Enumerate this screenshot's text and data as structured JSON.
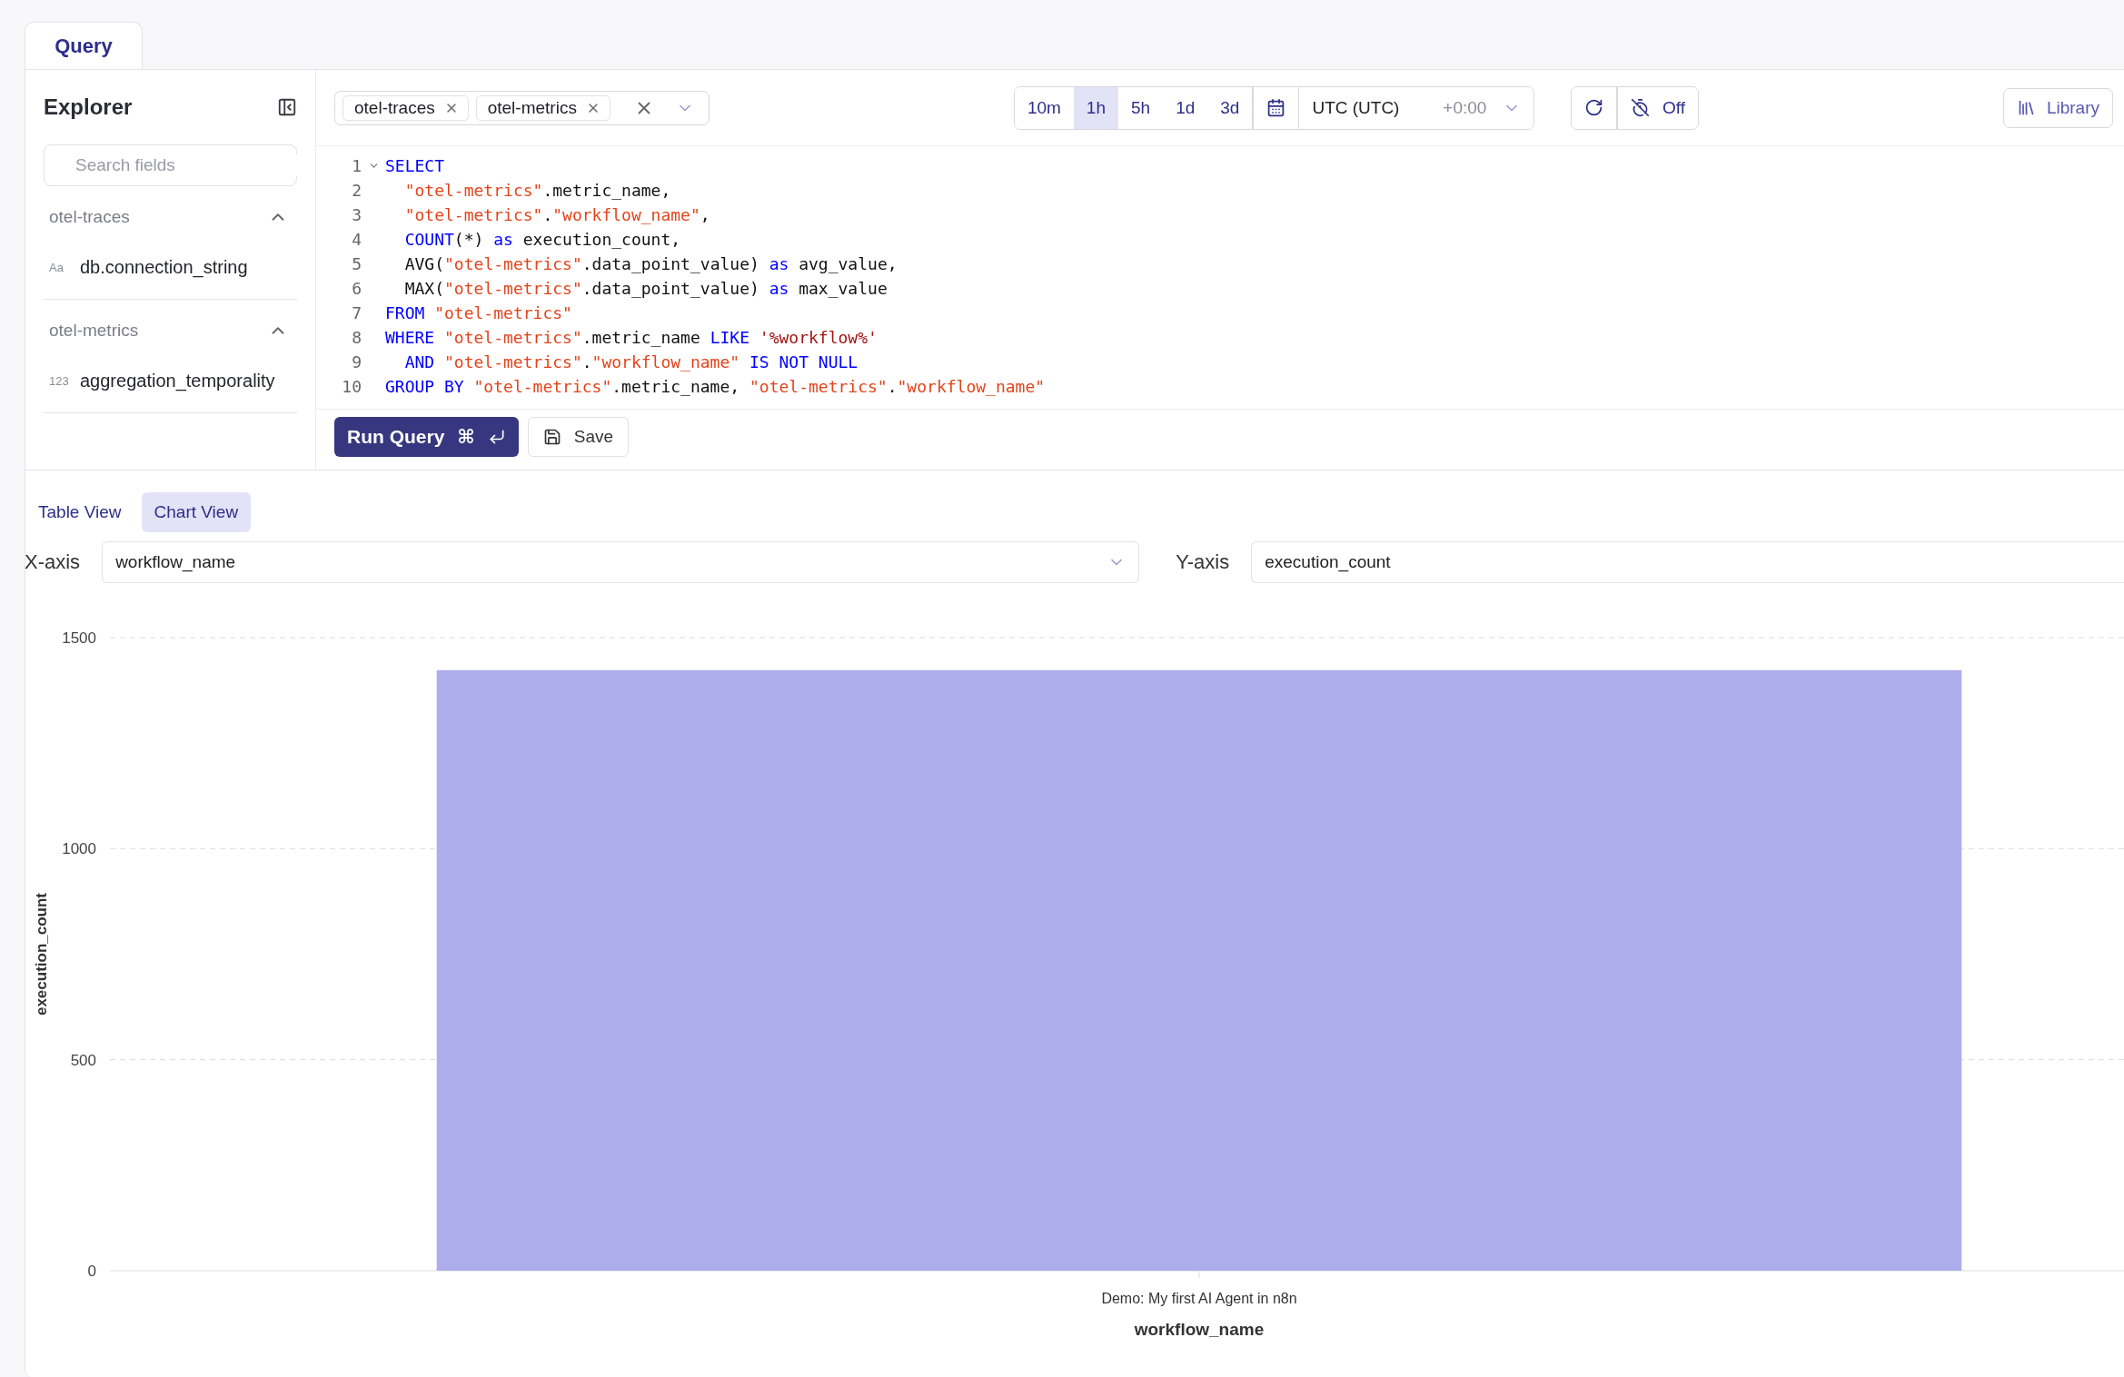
{
  "tabs": [
    {
      "label": "Query",
      "selected": true
    }
  ],
  "explorer": {
    "title": "Explorer",
    "search": {
      "placeholder": "Search fields"
    },
    "groups": [
      {
        "name": "otel-traces",
        "expanded": true,
        "fields": [
          {
            "type_label": "Aa",
            "name": "db.connection_string"
          }
        ]
      },
      {
        "name": "otel-metrics",
        "expanded": true,
        "fields": [
          {
            "type_label": "123",
            "name": "aggregation_temporality"
          }
        ]
      }
    ]
  },
  "sources": [
    "otel-traces",
    "otel-metrics"
  ],
  "time_ranges": [
    {
      "label": "10m",
      "selected": false
    },
    {
      "label": "1h",
      "selected": true
    },
    {
      "label": "5h",
      "selected": false
    },
    {
      "label": "1d",
      "selected": false
    },
    {
      "label": "3d",
      "selected": false
    }
  ],
  "timezone": {
    "name": "UTC (UTC)",
    "offset": "+0:00"
  },
  "auto_refresh": {
    "label": "Off"
  },
  "library_button": "Library",
  "editor": {
    "lines": [
      {
        "number": "1",
        "foldable": true,
        "indented": false,
        "tokens": [
          {
            "kind": "keyword",
            "text": "SELECT"
          }
        ]
      },
      {
        "number": "2",
        "foldable": false,
        "indented": true,
        "tokens": [
          {
            "kind": "identifier",
            "text": "\"otel-metrics\""
          },
          {
            "kind": "plain",
            "text": ".metric_name,"
          }
        ]
      },
      {
        "number": "3",
        "foldable": false,
        "indented": true,
        "tokens": [
          {
            "kind": "identifier",
            "text": "\"otel-metrics\""
          },
          {
            "kind": "plain",
            "text": "."
          },
          {
            "kind": "identifier",
            "text": "\"workflow_name\""
          },
          {
            "kind": "plain",
            "text": ","
          }
        ]
      },
      {
        "number": "4",
        "foldable": false,
        "indented": true,
        "tokens": [
          {
            "kind": "keyword",
            "text": "COUNT"
          },
          {
            "kind": "plain",
            "text": "(*) "
          },
          {
            "kind": "keyword",
            "text": "as"
          },
          {
            "kind": "plain",
            "text": " execution_count,"
          }
        ]
      },
      {
        "number": "5",
        "foldable": false,
        "indented": true,
        "tokens": [
          {
            "kind": "plain",
            "text": "AVG("
          },
          {
            "kind": "identifier",
            "text": "\"otel-metrics\""
          },
          {
            "kind": "plain",
            "text": ".data_point_value) "
          },
          {
            "kind": "keyword",
            "text": "as"
          },
          {
            "kind": "plain",
            "text": " avg_value,"
          }
        ]
      },
      {
        "number": "6",
        "foldable": false,
        "indented": true,
        "tokens": [
          {
            "kind": "plain",
            "text": "MAX("
          },
          {
            "kind": "identifier",
            "text": "\"otel-metrics\""
          },
          {
            "kind": "plain",
            "text": ".data_point_value) "
          },
          {
            "kind": "keyword",
            "text": "as"
          },
          {
            "kind": "plain",
            "text": " max_value"
          }
        ]
      },
      {
        "number": "7",
        "foldable": false,
        "indented": false,
        "tokens": [
          {
            "kind": "keyword",
            "text": "FROM"
          },
          {
            "kind": "identifier",
            "text": "\"otel-metrics\"",
            "space_before": true
          }
        ]
      },
      {
        "number": "8",
        "foldable": false,
        "indented": false,
        "tokens": [
          {
            "kind": "keyword",
            "text": "WHERE"
          },
          {
            "kind": "identifier",
            "text": "\"otel-metrics\"",
            "space_before": true
          },
          {
            "kind": "plain",
            "text": ".metric_name "
          },
          {
            "kind": "keyword",
            "text": "LIKE"
          },
          {
            "kind": "string",
            "text": "'%workflow%'",
            "space_before": true
          }
        ]
      },
      {
        "number": "9",
        "foldable": false,
        "indented": true,
        "tokens": [
          {
            "kind": "keyword",
            "text": "AND"
          },
          {
            "kind": "identifier",
            "text": "\"otel-metrics\"",
            "space_before": true
          },
          {
            "kind": "plain",
            "text": "."
          },
          {
            "kind": "identifier",
            "text": "\"workflow_name\""
          },
          {
            "kind": "keyword",
            "text": "IS NOT NULL",
            "space_before": true
          }
        ]
      },
      {
        "number": "10",
        "foldable": false,
        "indented": false,
        "tokens": [
          {
            "kind": "keyword",
            "text": "GROUP BY"
          },
          {
            "kind": "identifier",
            "text": "\"otel-metrics\"",
            "space_before": true
          },
          {
            "kind": "plain",
            "text": ".metric_name, "
          },
          {
            "kind": "identifier",
            "text": "\"otel-metrics\""
          },
          {
            "kind": "plain",
            "text": "."
          },
          {
            "kind": "identifier",
            "text": "\"workflow_name\""
          }
        ]
      }
    ]
  },
  "run_button": {
    "label": "Run Query",
    "shortcut": "⌘"
  },
  "save_button": "Save",
  "result_views": [
    {
      "label": "Table View",
      "selected": false
    },
    {
      "label": "Chart View",
      "selected": true
    }
  ],
  "x_axis": {
    "label": "X-axis",
    "value": "workflow_name"
  },
  "y_axis": {
    "label": "Y-axis",
    "value": "execution_count"
  },
  "chart_data": {
    "type": "bar",
    "xlabel": "workflow_name",
    "ylabel": "execution_count",
    "categories": [
      "Demo: My first AI Agent in n8n"
    ],
    "series": [
      {
        "color": "#adadeb",
        "values": [
          1423
        ]
      }
    ],
    "ylim": [
      0,
      1500
    ],
    "yticks": [
      0,
      500,
      1000,
      1500
    ]
  }
}
